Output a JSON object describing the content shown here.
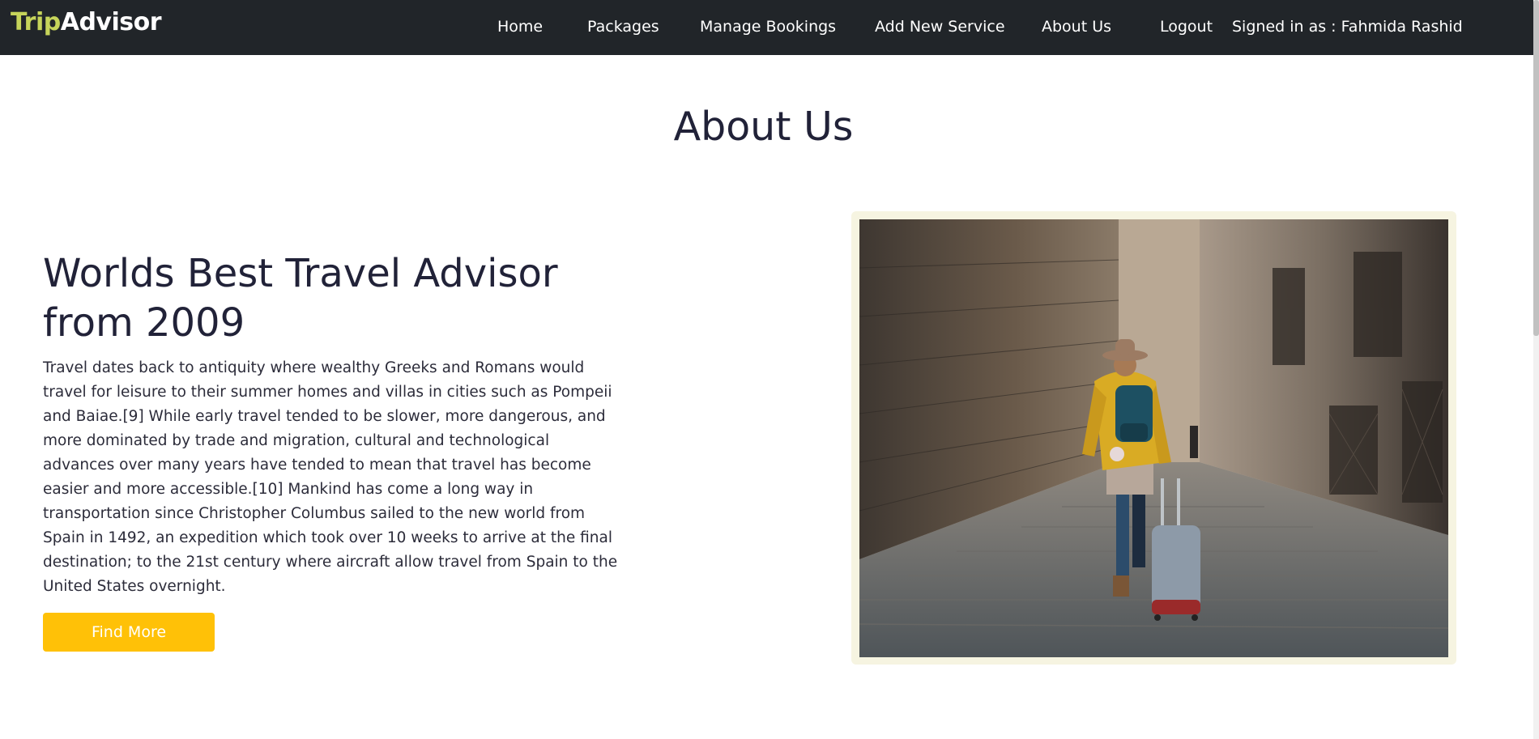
{
  "nav": {
    "brand_part1": "Trip",
    "brand_part2": "Advisor",
    "items": [
      "Home",
      "Packages",
      "Manage Bookings",
      "Add New Service",
      "About Us"
    ],
    "logout": "Logout",
    "signed_in": "Signed in as : Fahmida Rashid"
  },
  "main": {
    "title": "About Us",
    "feature_title": "Worlds Best Travel Advisor from 2009",
    "feature_text": "Travel dates back to antiquity where wealthy Greeks and Romans would travel for leisure to their summer homes and villas in cities such as Pompeii and Baiae.[9] While early travel tended to be slower, more dangerous, and more dominated by trade and migration, cultural and technological advances over many years have tended to mean that travel has become easier and more accessible.[10] Mankind has come a long way in transportation since Christopher Columbus sailed to the new world from Spain in 1492, an expedition which took over 10 weeks to arrive at the final destination; to the 21st century where aircraft allow travel from Spain to the United States overnight.",
    "button_label": "Find More"
  },
  "colors": {
    "navbar_bg": "#212529",
    "brand_accent": "#c6d45a",
    "button_bg": "#ffc107",
    "image_frame": "#f6f4e1",
    "heading": "#212238"
  }
}
